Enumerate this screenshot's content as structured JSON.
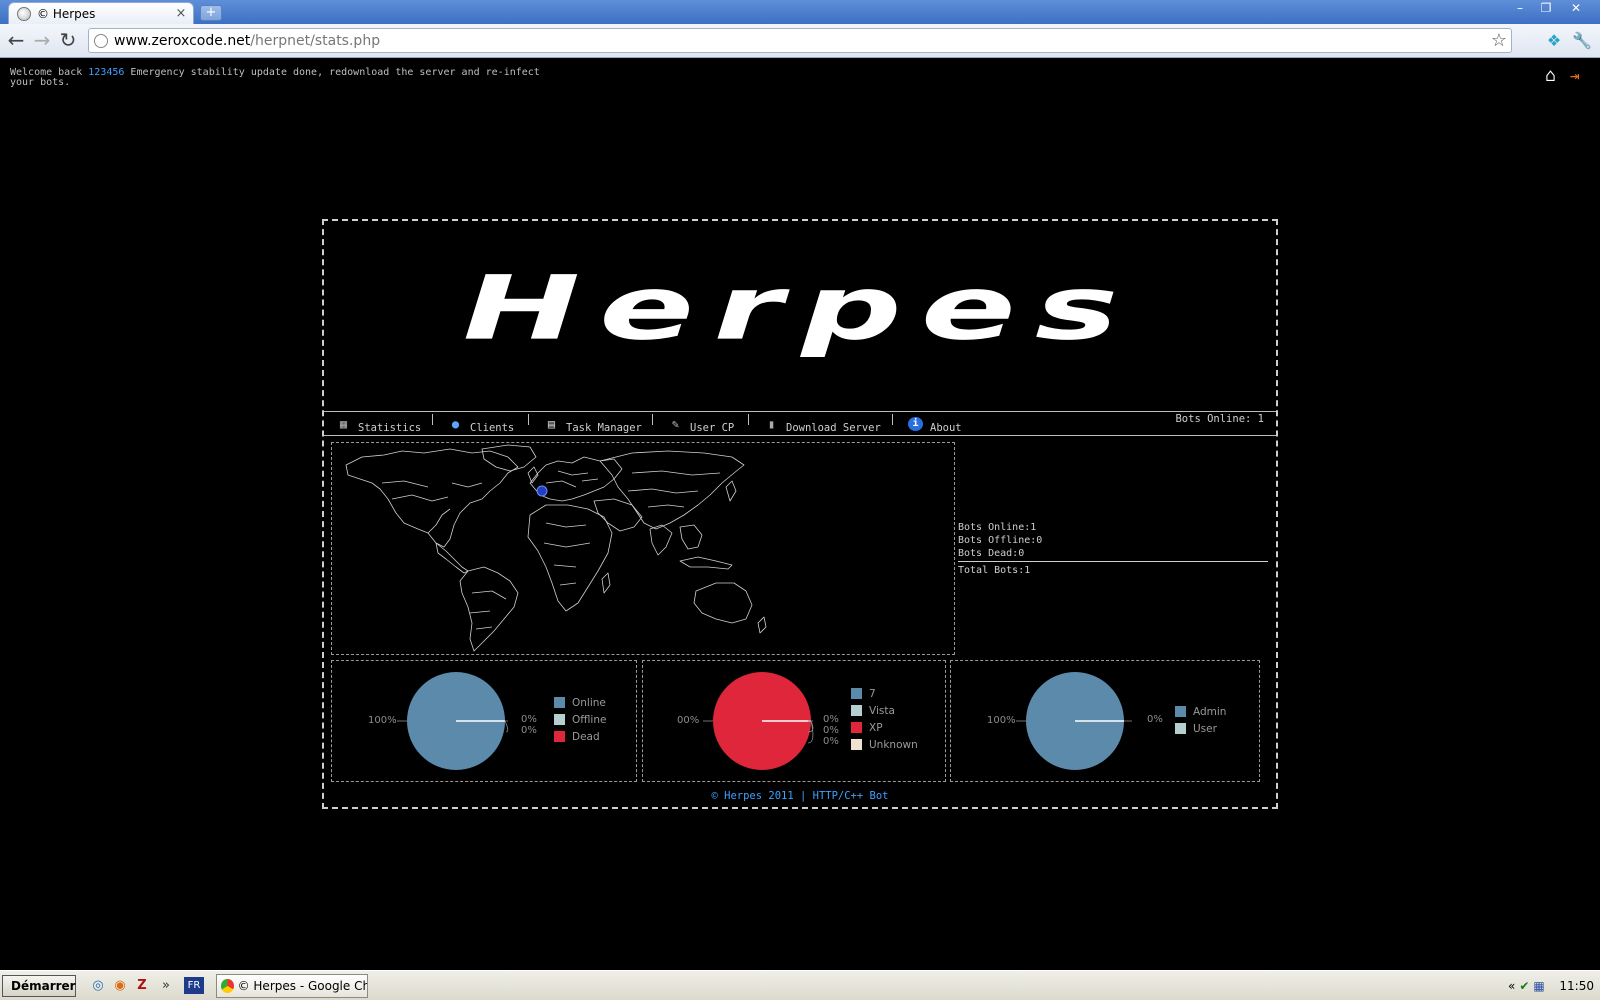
{
  "browser": {
    "tab_title": "© Herpes",
    "new_tab": "+",
    "url_host": "www.zeroxcode.net",
    "url_path": "/herpnet/stats.php",
    "window_controls": [
      "–",
      "❐",
      "✕"
    ]
  },
  "page": {
    "welcome_prefix": "Welcome back ",
    "username": "123456",
    "welcome_message": " Emergency stability update done, redownload the server and re-infect your bots.",
    "logo_text": "Herpes",
    "nav": [
      {
        "label": "Statistics",
        "icon": "chart-icon"
      },
      {
        "label": "Clients",
        "icon": "user-icon"
      },
      {
        "label": "Task Manager",
        "icon": "window-icon"
      },
      {
        "label": "User CP",
        "icon": "tools-icon"
      },
      {
        "label": "Download Server",
        "icon": "server-icon"
      },
      {
        "label": "About",
        "icon": "info-icon"
      }
    ],
    "bots_online_header": "Bots Online: 1",
    "stats": {
      "online": "Bots Online:1",
      "offline": "Bots Offline:0",
      "dead": "Bots Dead:0",
      "total": "Total Bots:1"
    },
    "footer": "© Herpes 2011 | HTTP/C++ Bot"
  },
  "chart_data": [
    {
      "type": "pie",
      "categories": [
        "Online",
        "Offline",
        "Dead"
      ],
      "values": [
        100,
        0,
        0
      ],
      "colors": [
        "#5c8aaa",
        "#b5cfd0",
        "#e0263a"
      ],
      "labels": [
        "100%",
        "0%",
        "0%"
      ]
    },
    {
      "type": "pie",
      "categories": [
        "7",
        "Vista",
        "XP",
        "Unknown"
      ],
      "values": [
        0,
        0,
        100,
        0
      ],
      "colors": [
        "#5c8aaa",
        "#b5cfd0",
        "#e0263a",
        "#efe2cf"
      ],
      "labels": [
        "00%",
        "0%",
        "0%",
        "0%"
      ]
    },
    {
      "type": "pie",
      "categories": [
        "Admin",
        "User"
      ],
      "values": [
        100,
        0
      ],
      "colors": [
        "#5c8aaa",
        "#b5cfd0"
      ],
      "labels": [
        "100%",
        "0%"
      ]
    }
  ],
  "taskbar": {
    "start_label": "Démarrer",
    "lang": "FR",
    "task_label": "© Herpes - Google Ch...",
    "clock": "11:50",
    "more": "»"
  }
}
